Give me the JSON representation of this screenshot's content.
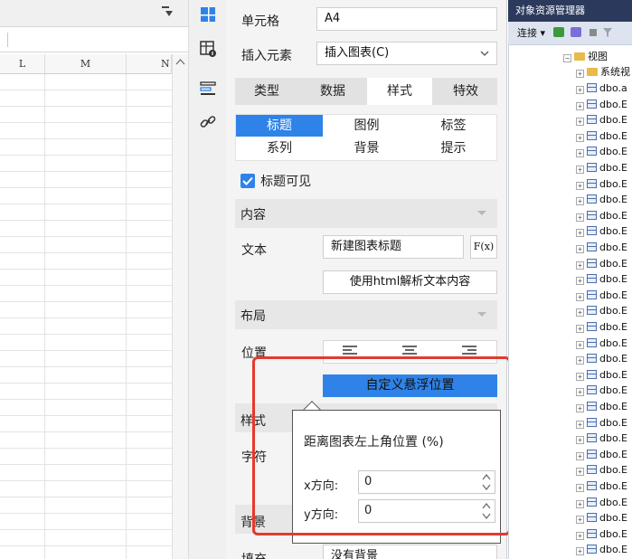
{
  "sheet": {
    "columns": [
      "L",
      "M",
      "N"
    ]
  },
  "panel": {
    "cell_label": "单元格",
    "cell_value": "A4",
    "insert_label": "插入元素",
    "insert_value": "插入图表(C)",
    "tabs": [
      {
        "label": "类型"
      },
      {
        "label": "数据"
      },
      {
        "label": "样式"
      },
      {
        "label": "特效"
      }
    ],
    "subtabs": [
      {
        "label": "标题"
      },
      {
        "label": "图例"
      },
      {
        "label": "标签"
      },
      {
        "label": "系列"
      },
      {
        "label": "背景"
      },
      {
        "label": "提示"
      }
    ],
    "title_visible_label": "标题可见",
    "content_section": "内容",
    "text_label": "文本",
    "text_value": "新建图表标题",
    "fx_label": "F(x)",
    "html_button": "使用html解析文本内容",
    "layout_section": "布局",
    "position_label": "位置",
    "custom_float_button": "自定义悬浮位置",
    "style_section": "样式",
    "font_label": "字符",
    "background_section": "背景",
    "fill_label": "填充",
    "fill_value": "没有背景"
  },
  "popup": {
    "title": "距离图表左上角位置 (%)",
    "x_label": "x方向:",
    "x_value": "0",
    "y_label": "y方向:",
    "y_value": "0"
  },
  "explorer": {
    "title": "对象资源管理器",
    "connect": "连接",
    "view_node": "视图",
    "system_node": "系统视",
    "rows": [
      "dbo.a",
      "dbo.E",
      "dbo.E",
      "dbo.E",
      "dbo.E",
      "dbo.E",
      "dbo.E",
      "dbo.E",
      "dbo.E",
      "dbo.E",
      "dbo.E",
      "dbo.E",
      "dbo.E",
      "dbo.E",
      "dbo.E",
      "dbo.E",
      "dbo.E",
      "dbo.E",
      "dbo.E",
      "dbo.E",
      "dbo.E",
      "dbo.E",
      "dbo.E",
      "dbo.E",
      "dbo.E",
      "dbo.E",
      "dbo.E",
      "dbo.E",
      "dbo.E",
      "dbo.E",
      "dbo.E"
    ]
  },
  "colors": {
    "accent": "#2f83e8",
    "highlight": "#e43a2f",
    "explorer_title": "#2b3a5c"
  }
}
